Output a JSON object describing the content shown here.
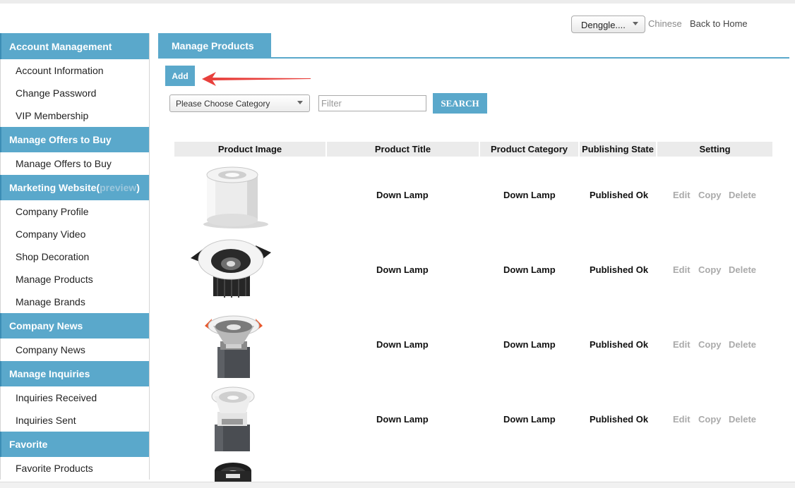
{
  "header": {
    "lang_select_value": "Denggle....",
    "link_chinese": "Chinese",
    "link_home": "Back to Home"
  },
  "sidebar": {
    "account": {
      "title": "Account Management",
      "items": [
        "Account Information",
        "Change Password",
        "VIP Membership"
      ]
    },
    "offers": {
      "title": "Manage Offers to Buy",
      "items": [
        "Manage Offers to Buy"
      ]
    },
    "marketing": {
      "title": "Marketing Website",
      "title_paren_open": "(",
      "title_preview": "preview",
      "title_paren_close": ")",
      "items": [
        "Company Profile",
        "Company Video",
        "Shop Decoration",
        "Manage Products",
        "Manage Brands"
      ]
    },
    "news": {
      "title": "Company News",
      "items": [
        "Company News"
      ]
    },
    "inquiries": {
      "title": "Manage Inquiries",
      "items": [
        "Inquiries Received",
        "Inquiries Sent"
      ]
    },
    "favorite": {
      "title": "Favorite",
      "items": [
        "Favorite Products"
      ]
    }
  },
  "main": {
    "tab_title": "Manage Products",
    "add_label": "Add",
    "category_select_value": "Please Choose Category",
    "filter_placeholder": "Filter",
    "search_label": "SEARCH"
  },
  "table": {
    "headers": [
      "Product Image",
      "Product Title",
      "Product Category",
      "Publishing State",
      "Setting"
    ],
    "actions": [
      "Edit",
      "Copy",
      "Delete"
    ],
    "rows": [
      {
        "title": "Down Lamp",
        "category": "Down Lamp",
        "state": "Published Ok"
      },
      {
        "title": "Down Lamp",
        "category": "Down Lamp",
        "state": "Published Ok"
      },
      {
        "title": "Down Lamp",
        "category": "Down Lamp",
        "state": "Published Ok"
      },
      {
        "title": "Down Lamp",
        "category": "Down Lamp",
        "state": "Published Ok"
      }
    ]
  },
  "colors": {
    "accent": "#5aa8cb",
    "arrow": "#e8403c",
    "action_text": "#aaaaaa"
  },
  "icons": [
    "caret-down-icon",
    "red-arrow-icon",
    "product-image-down-lamp"
  ]
}
